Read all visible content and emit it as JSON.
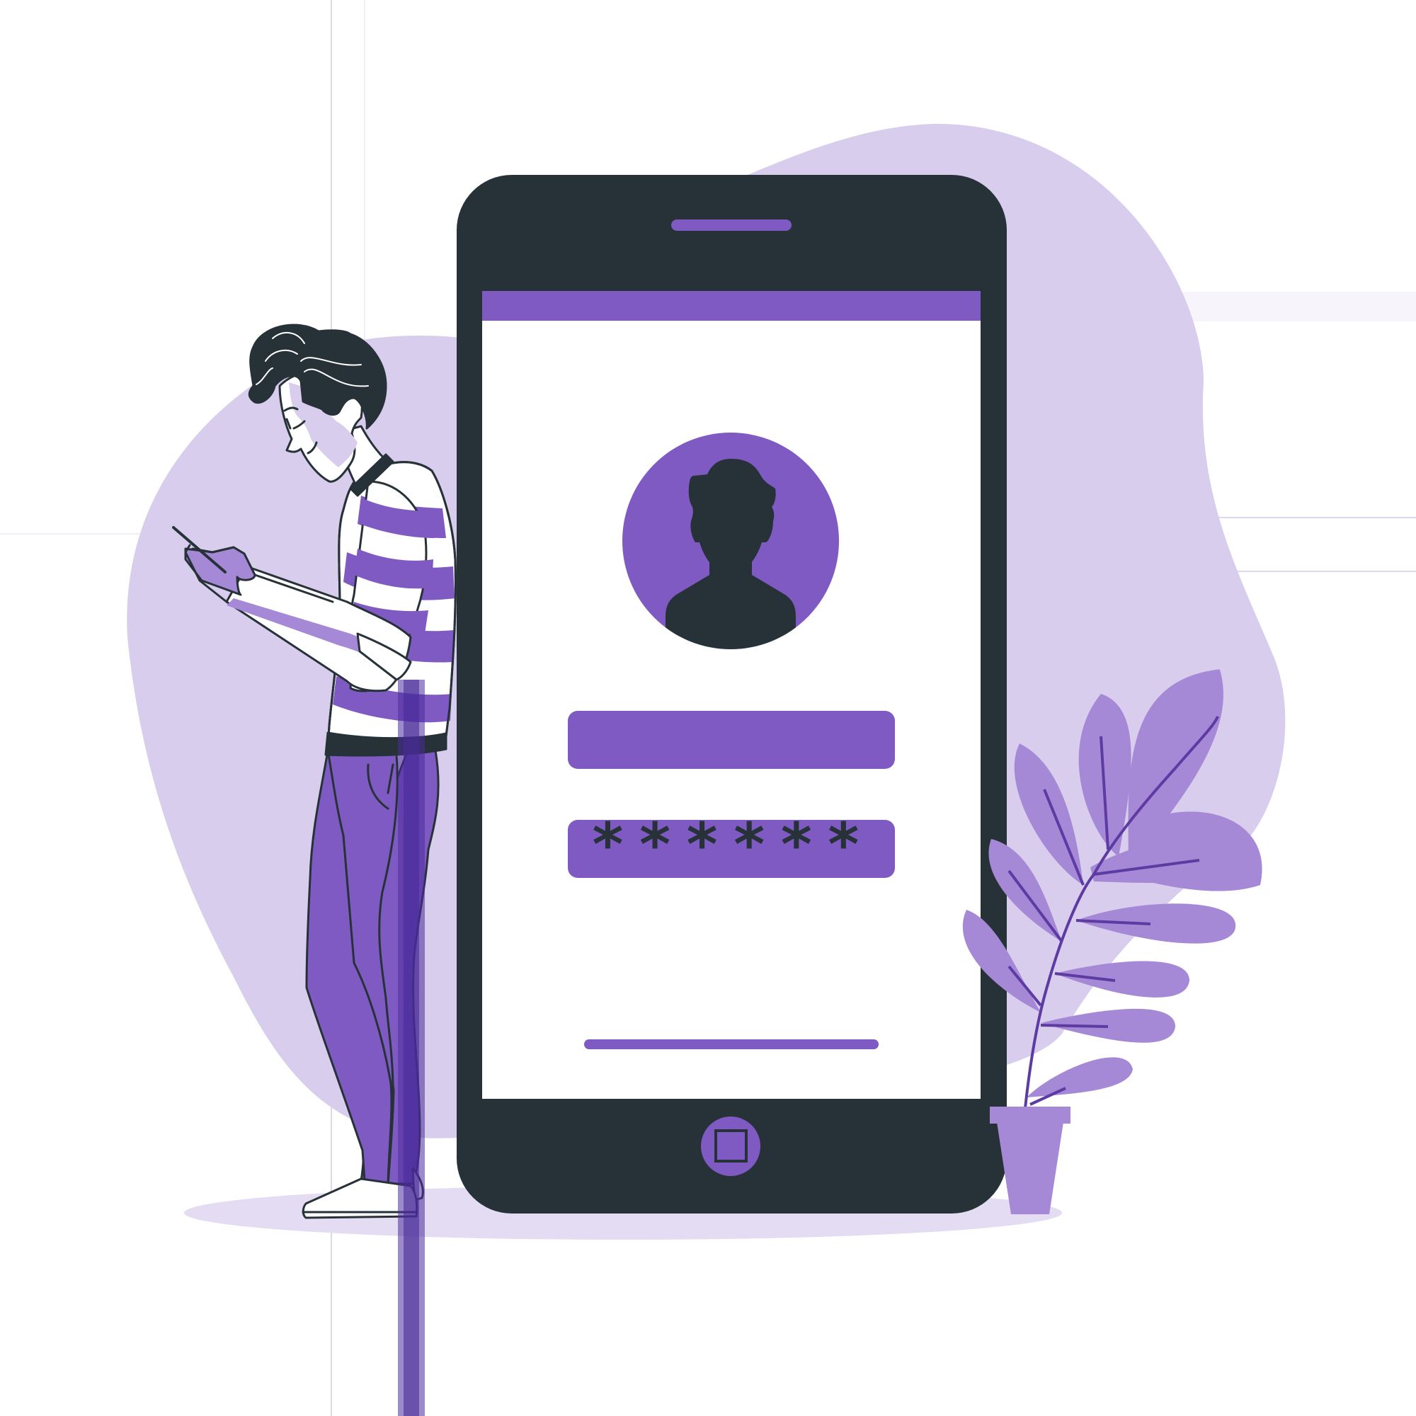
{
  "illustration": {
    "subject": "login",
    "colors": {
      "primary": "#7f5ac3",
      "primary_dark": "#4a2b9a",
      "light": "#d8cdec",
      "soft": "#e4dcf2",
      "leaf": "#a689d6",
      "dark": "#263238",
      "white": "#ffffff"
    }
  },
  "phone": {
    "password_field": {
      "masked_value": "******"
    }
  },
  "icons": {
    "avatar": "user-silhouette-icon",
    "home": "square-home-icon",
    "speaker": "speaker-slot-icon"
  }
}
